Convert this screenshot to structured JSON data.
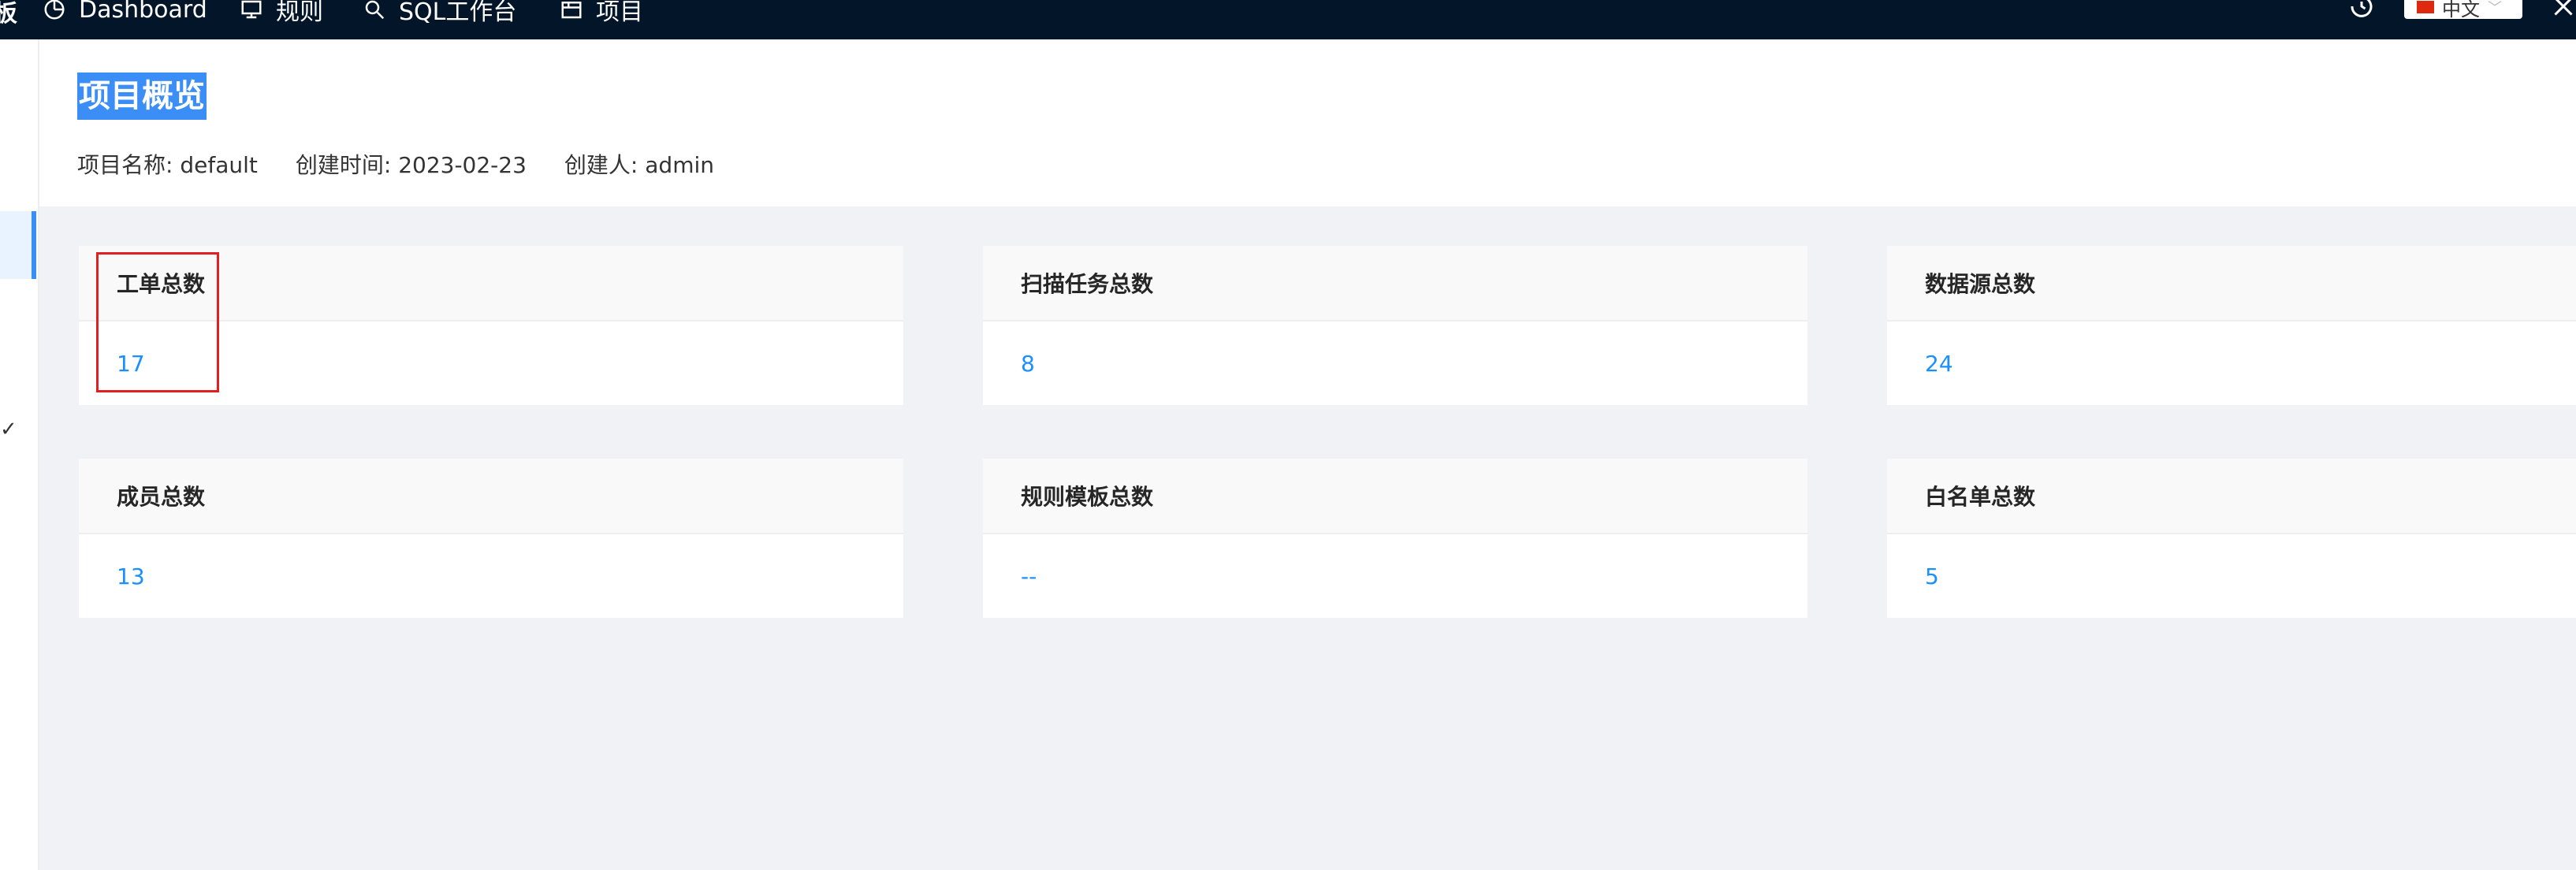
{
  "nav": {
    "brand": "板",
    "items": [
      {
        "label": "Dashboard",
        "icon": "dashboard-icon"
      },
      {
        "label": "规则",
        "icon": "monitor-icon"
      },
      {
        "label": "SQL工作台",
        "icon": "search-icon"
      },
      {
        "label": "项目",
        "icon": "project-icon"
      }
    ],
    "language": "中文"
  },
  "page": {
    "title": "项目概览",
    "project_name": "项目名称: default",
    "created_time": "创建时间: 2023-02-23",
    "creator": "创建人: admin"
  },
  "stats": [
    {
      "title": "工单总数",
      "value": "17"
    },
    {
      "title": "扫描任务总数",
      "value": "8"
    },
    {
      "title": "数据源总数",
      "value": "24"
    },
    {
      "title": "成员总数",
      "value": "13"
    },
    {
      "title": "规则模板总数",
      "value": "--"
    },
    {
      "title": "白名单总数",
      "value": "5"
    }
  ],
  "colors": {
    "topbar": "#021529",
    "accent": "#1890ff",
    "highlight": "#e02020"
  }
}
